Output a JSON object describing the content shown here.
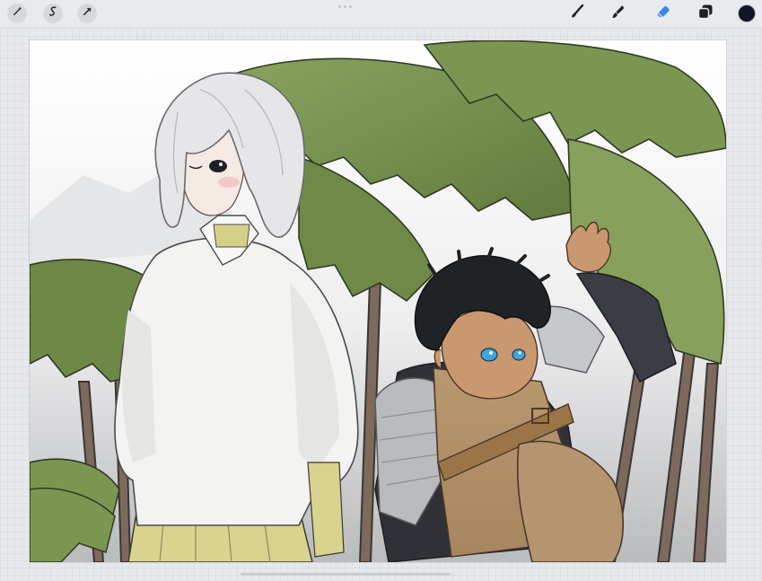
{
  "toolbar": {
    "left_tools": [
      {
        "name": "adjustments-icon"
      },
      {
        "name": "selection-icon"
      },
      {
        "name": "transform-icon"
      }
    ],
    "right_tools": [
      {
        "name": "brush-icon"
      },
      {
        "name": "smudge-icon"
      },
      {
        "name": "eraser-icon"
      },
      {
        "name": "layers-icon"
      }
    ],
    "active_tool": "eraser",
    "accent_color": "#3a86e8",
    "current_color": "#101623"
  },
  "canvas": {
    "content": "illustration-two-characters-under-leaves",
    "palette": {
      "leaf": "#7f9a55",
      "leaf_dark": "#5f7a3c",
      "hair_light": "#e6e6e8",
      "hair_dark": "#1f2326",
      "shirt": "#f3f3f1",
      "skin_dark": "#c9986e",
      "eyes": "#39a7e0",
      "vest": "#b8986f"
    }
  }
}
